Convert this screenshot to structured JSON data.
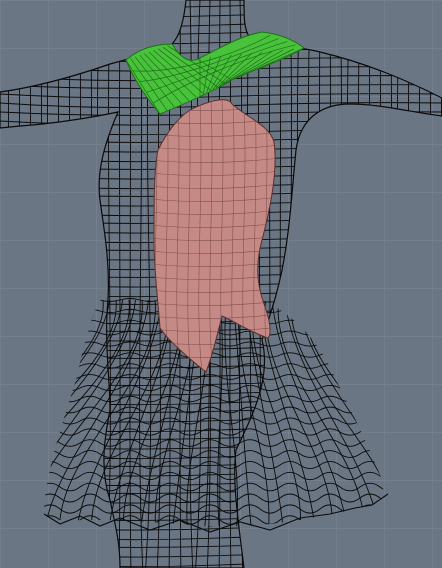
{
  "viewport": {
    "background": "#6b7685",
    "grid_color": "#7c8795",
    "wire_color": "#0a0a0a"
  },
  "scene": {
    "objects": [
      {
        "name": "body-wireframe",
        "display": "wireframe"
      },
      {
        "name": "collar",
        "display": "shaded",
        "color": "#48c23a"
      },
      {
        "name": "bodice-panel",
        "display": "shaded",
        "color": "#c58a86"
      },
      {
        "name": "skirt-wireframe",
        "display": "wireframe"
      }
    ]
  }
}
